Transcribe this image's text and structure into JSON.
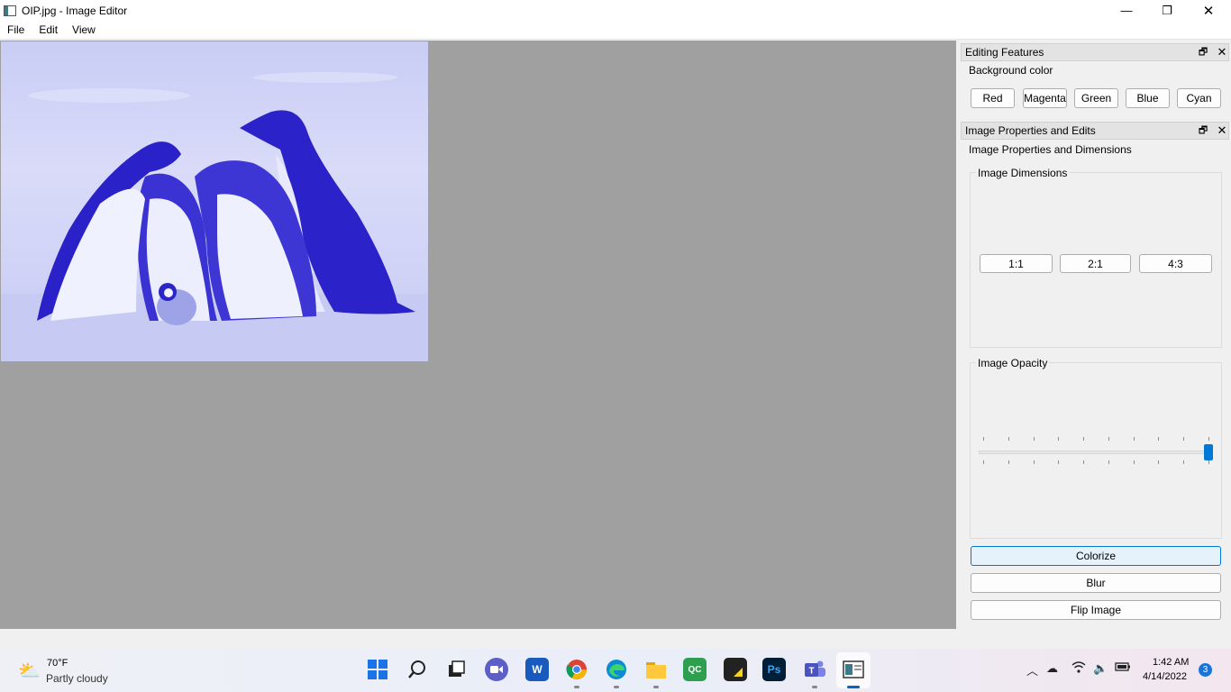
{
  "window": {
    "title": "OIP.jpg - Image Editor",
    "controls": {
      "minimize": "—",
      "maximize": "❐",
      "close": "✕"
    }
  },
  "menu": [
    "File",
    "Edit",
    "View"
  ],
  "canvas": {
    "background": "#a0a0a0",
    "image_tint": "#3a35d6"
  },
  "editing_features": {
    "title": "Editing Features",
    "background_color_label": "Background color",
    "colors": [
      "Red",
      "Magenta",
      "Green",
      "Blue",
      "Cyan"
    ]
  },
  "image_properties": {
    "title": "Image Properties and Edits",
    "subtitle": "Image Properties and Dimensions",
    "dimensions_group": "Image Dimensions",
    "ratios": [
      "1:1",
      "2:1",
      "4:3"
    ],
    "opacity_group": "Image Opacity",
    "opacity_level": 1.0,
    "actions": [
      "Colorize",
      "Blur",
      "Flip Image"
    ]
  },
  "taskbar": {
    "weather": {
      "temp": "70°F",
      "desc": "Partly cloudy"
    },
    "apps": [
      "start-icon",
      "search-icon",
      "task-view-icon",
      "chat-icon",
      "word-icon",
      "chrome-icon",
      "edge-icon",
      "file-explorer-icon",
      "qc-icon",
      "sticky-notes-icon",
      "photoshop-icon",
      "teams-icon",
      "image-editor-icon"
    ],
    "app_labels": {
      "word": "W",
      "qc": "QC",
      "ps": "Ps"
    },
    "clock": {
      "time": "1:42 AM",
      "date": "4/14/2022"
    },
    "notifications": "3"
  }
}
